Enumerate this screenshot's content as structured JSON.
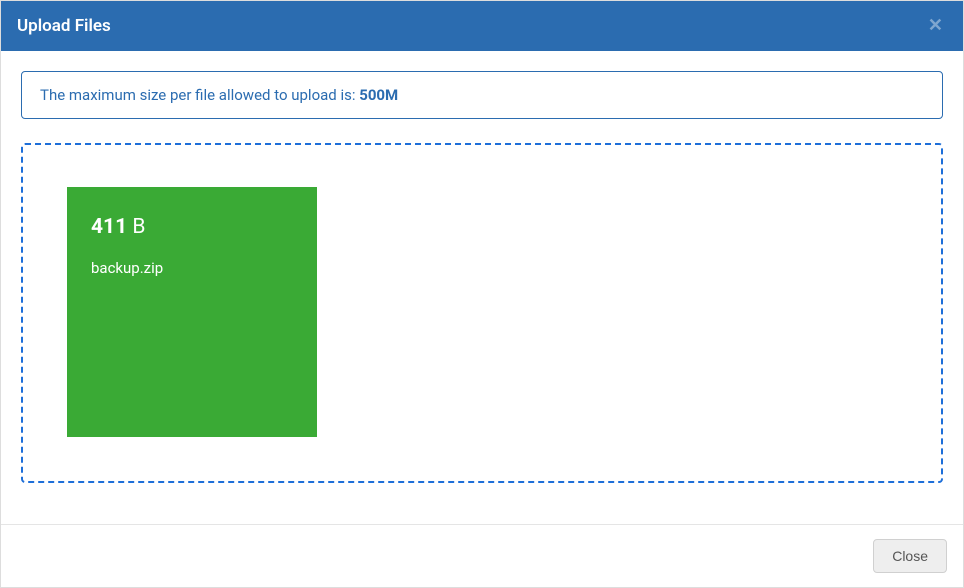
{
  "header": {
    "title": "Upload Files"
  },
  "banner": {
    "text_prefix": "The maximum size per file allowed to upload is: ",
    "max_size": "500M"
  },
  "files": [
    {
      "size_value": "411",
      "size_unit": "B",
      "name": "backup.zip"
    }
  ],
  "footer": {
    "close_label": "Close"
  }
}
